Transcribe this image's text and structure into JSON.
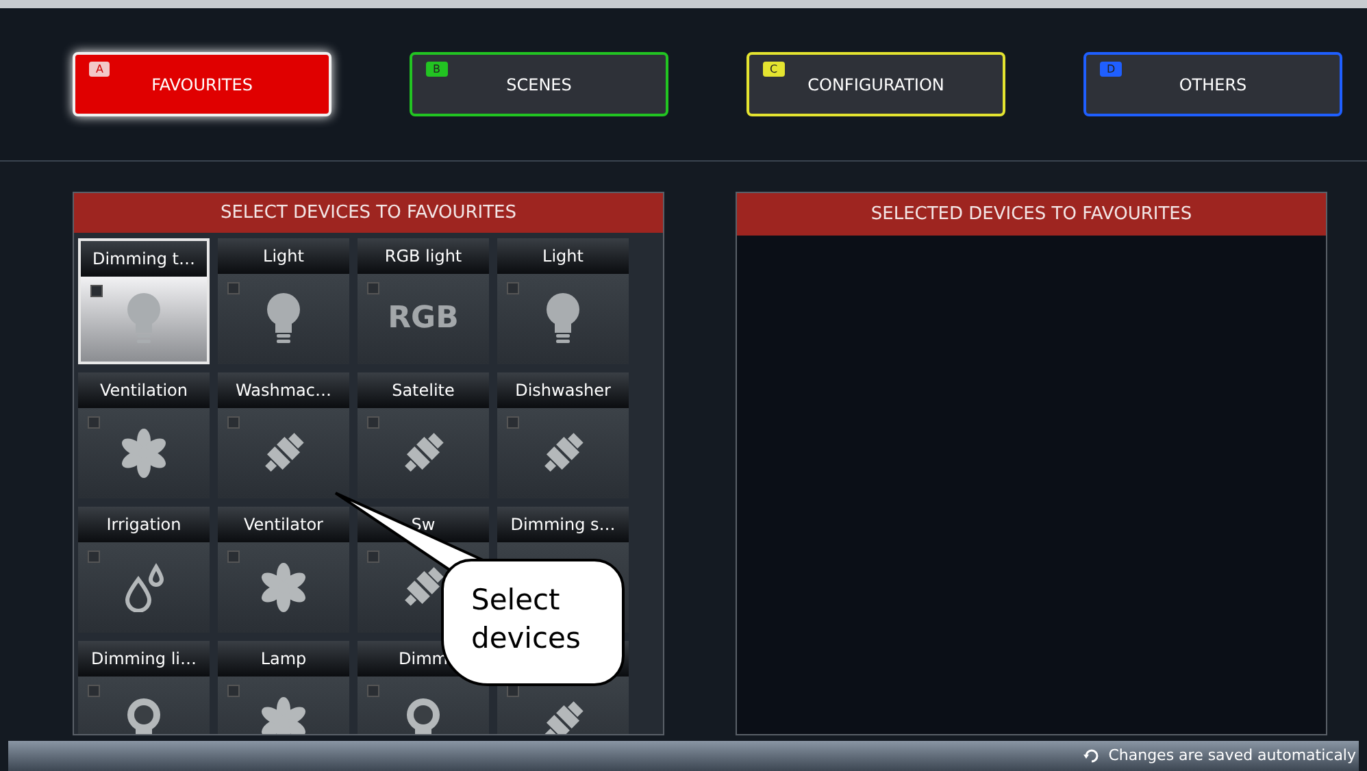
{
  "tabs": [
    {
      "letter": "A",
      "label": "FAVOURITES",
      "color": "#e00000",
      "selected": true
    },
    {
      "letter": "B",
      "label": "SCENES",
      "color": "#22c422",
      "selected": false
    },
    {
      "letter": "C",
      "label": "CONFIGURATION",
      "color": "#e4e430",
      "selected": false
    },
    {
      "letter": "D",
      "label": "OTHERS",
      "color": "#1f5fff",
      "selected": false
    }
  ],
  "device_panel": {
    "title": "SELECT DEVICES TO FAVOURITES",
    "devices": [
      {
        "label": "Dimming t…",
        "kind": "bulb",
        "selected": true,
        "checked": false
      },
      {
        "label": "Light",
        "kind": "bulb",
        "selected": false,
        "checked": false
      },
      {
        "label": "RGB light",
        "kind": "rgb",
        "icon_text": "RGB",
        "selected": false,
        "checked": false
      },
      {
        "label": "Light",
        "kind": "bulb",
        "selected": false,
        "checked": false
      },
      {
        "label": "Ventilation",
        "kind": "fan",
        "selected": false,
        "checked": false
      },
      {
        "label": "Washmac…",
        "kind": "plug",
        "selected": false,
        "checked": false
      },
      {
        "label": "Satelite",
        "kind": "plug",
        "selected": false,
        "checked": false
      },
      {
        "label": "Dishwasher",
        "kind": "plug",
        "selected": false,
        "checked": false
      },
      {
        "label": "Irrigation",
        "kind": "drops",
        "selected": false,
        "checked": false
      },
      {
        "label": "Ventilator",
        "kind": "fan",
        "selected": false,
        "checked": false
      },
      {
        "label": "Sw",
        "kind": "plug",
        "selected": false,
        "checked": false
      },
      {
        "label": "Dimming s…",
        "kind": "none",
        "selected": false
      },
      {
        "label": "Dimming li…",
        "kind": "dimmer",
        "selected": false,
        "checked": false
      },
      {
        "label": "Lamp",
        "kind": "fan",
        "selected": false,
        "checked": false
      },
      {
        "label": "Dimm",
        "kind": "dimmer",
        "selected": false,
        "checked": false
      },
      {
        "kind": "plug",
        "selected": false,
        "checked": false
      }
    ]
  },
  "selected_panel": {
    "title": "SELECTED DEVICES TO FAVOURITES"
  },
  "callout": {
    "text": "Select devices"
  },
  "status_bar": {
    "text": "Changes are saved automaticaly"
  }
}
